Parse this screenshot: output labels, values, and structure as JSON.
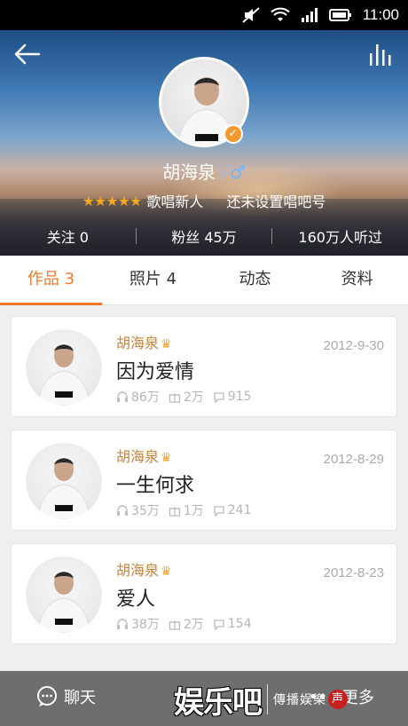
{
  "status_bar": {
    "time": "11:00",
    "icons": [
      "mute-icon",
      "wifi-icon",
      "signal-icon",
      "battery-icon"
    ]
  },
  "header": {
    "name": "胡海泉",
    "verified_mark": "V",
    "gender_symbol": "♂",
    "rating_stars": 5,
    "level": "歌唱新人",
    "singbar_id": "还未设置唱吧号",
    "stats": [
      {
        "label": "关注 0"
      },
      {
        "label": "粉丝 45万"
      },
      {
        "label": "160万人听过"
      }
    ]
  },
  "tabs": [
    {
      "label": "作品 3",
      "active": true
    },
    {
      "label": "照片 4",
      "active": false
    },
    {
      "label": "动态",
      "active": false
    },
    {
      "label": "资料",
      "active": false
    }
  ],
  "works": [
    {
      "author": "胡海泉",
      "title": "因为爱情",
      "date": "2012-9-30",
      "listens": "86万",
      "gifts": "2万",
      "comments": "915"
    },
    {
      "author": "胡海泉",
      "title": "一生何求",
      "date": "2012-8-29",
      "listens": "35万",
      "gifts": "1万",
      "comments": "241"
    },
    {
      "author": "胡海泉",
      "title": "爱人",
      "date": "2012-8-23",
      "listens": "38万",
      "gifts": "2万",
      "comments": "154"
    }
  ],
  "bottom_bar": {
    "chat_label": "聊天",
    "more_label": "更多"
  },
  "watermark": {
    "brand": "娱乐吧",
    "tagline": "傳播娱樂",
    "seal": "声"
  },
  "colors": {
    "accent": "#f07a2a",
    "author": "#c9843c",
    "star": "#f5a623",
    "bottom_bar": "#6e6e6e"
  }
}
